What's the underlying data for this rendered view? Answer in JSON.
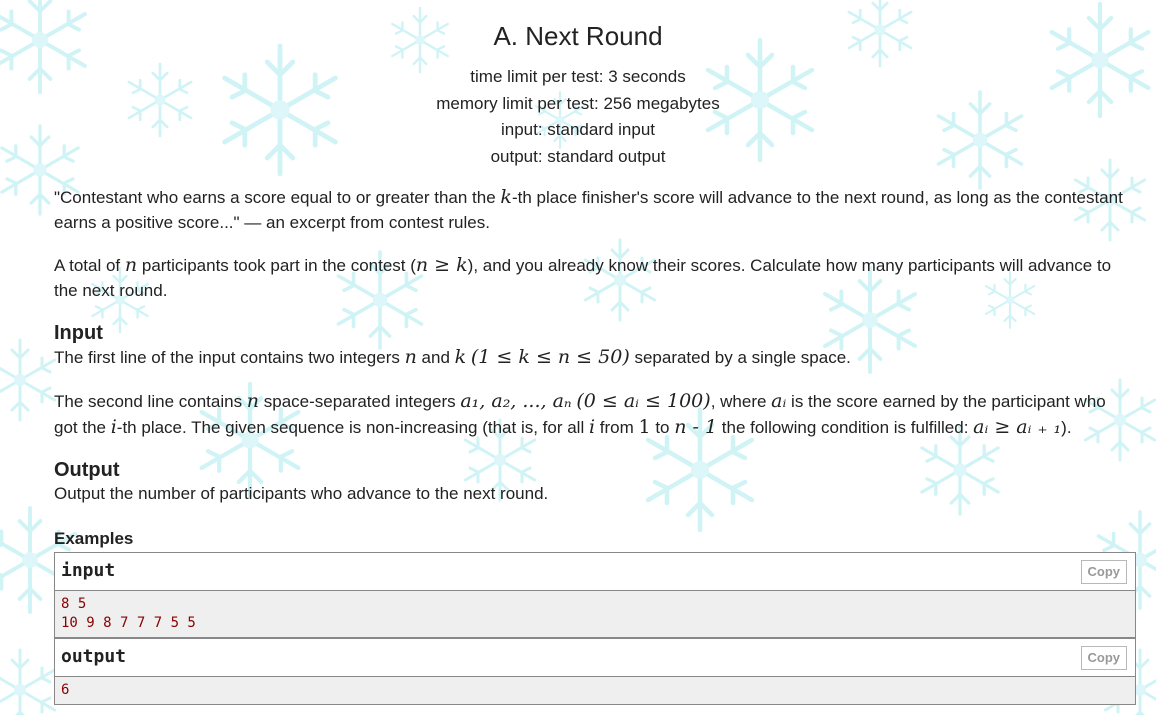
{
  "problem": {
    "title": "A. Next Round",
    "time_limit": "time limit per test: 3 seconds",
    "memory_limit": "memory limit per test: 256 megabytes",
    "input_file": "input: standard input",
    "output_file": "output: standard output"
  },
  "statement": {
    "p1_a": "\"Contestant who earns a score equal to or greater than the ",
    "p1_var": "k",
    "p1_b": "-th place finisher's score will advance to the next round, as long as the contestant earns a positive score...\" — an excerpt from contest rules.",
    "p2_a": "A total of ",
    "p2_var_n": "n",
    "p2_b": " participants took part in the contest (",
    "p2_math": "n ≥ k",
    "p2_c": "), and you already know their scores. Calculate how many participants will advance to the next round."
  },
  "input_section": {
    "heading": "Input",
    "l1_a": "The first line of the input contains two integers ",
    "l1_n": "n",
    "l1_b": " and ",
    "l1_k": "k",
    "l1_math": "(1 ≤ k ≤ n ≤ 50)",
    "l1_c": " separated by a single space.",
    "l2_a": "The second line contains ",
    "l2_n": "n",
    "l2_b": " space-separated integers ",
    "l2_seq": "a₁, a₂, ..., aₙ",
    "l2_range": "(0 ≤ aᵢ ≤ 100)",
    "l2_c": ", where ",
    "l2_ai": "aᵢ",
    "l2_d": " is the score earned by the participant who got the ",
    "l2_i": "i",
    "l2_e": "-th place. The given sequence is non-increasing (that is, for all ",
    "l2_i2": "i",
    "l2_f": " from ",
    "l2_one": "1",
    "l2_g": " to ",
    "l2_nm1": "n - 1",
    "l2_h": " the following condition is fulfilled: ",
    "l2_cond": "aᵢ ≥ aᵢ ₊ ₁",
    "l2_end": ")."
  },
  "output_section": {
    "heading": "Output",
    "text": "Output the number of participants who advance to the next round."
  },
  "examples": {
    "heading": "Examples",
    "input_label": "input",
    "input_copy": "Copy",
    "input_value": "8 5\n10 9 8 7 7 7 5 5",
    "output_label": "output",
    "output_copy": "Copy",
    "output_value": "6"
  },
  "colors": {
    "snowflake": "#c8f1f5",
    "sample_text": "#8b0000",
    "sample_bg": "#efefef",
    "border": "#888888"
  }
}
